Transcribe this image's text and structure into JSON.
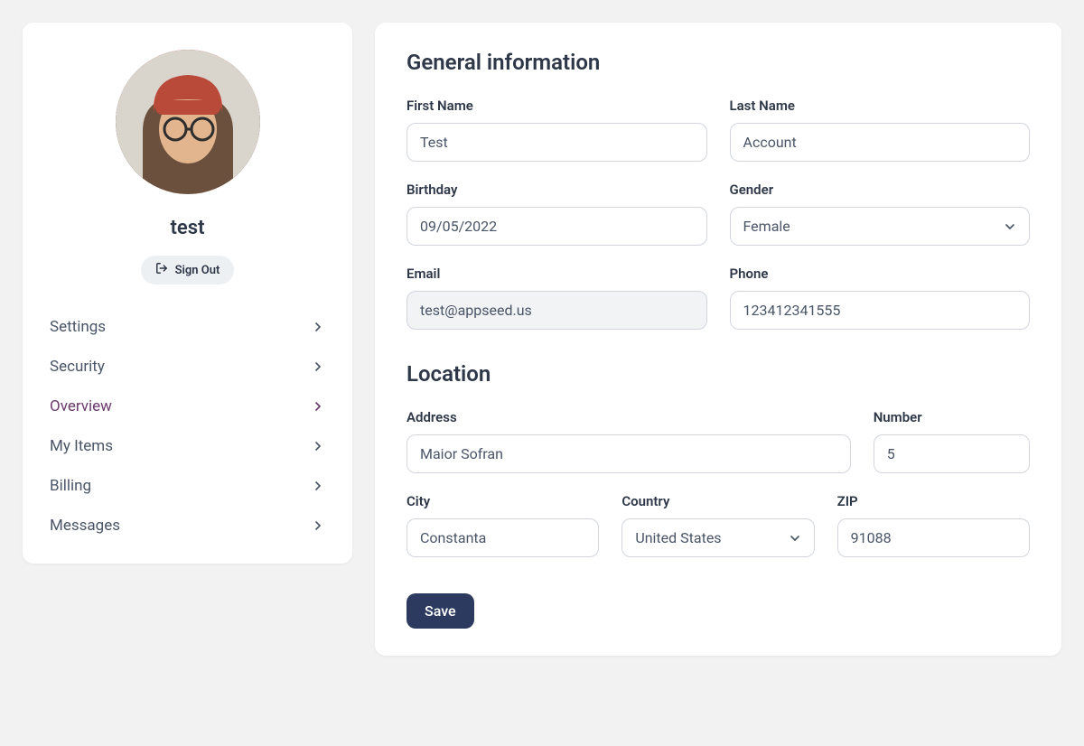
{
  "sidebar": {
    "username": "test",
    "signout_label": "Sign Out",
    "items": [
      {
        "label": "Settings",
        "active": false
      },
      {
        "label": "Security",
        "active": false
      },
      {
        "label": "Overview",
        "active": true
      },
      {
        "label": "My Items",
        "active": false
      },
      {
        "label": "Billing",
        "active": false
      },
      {
        "label": "Messages",
        "active": false
      }
    ]
  },
  "form": {
    "section_general": "General information",
    "section_location": "Location",
    "first_name_label": "First Name",
    "first_name_value": "Test",
    "last_name_label": "Last Name",
    "last_name_value": "Account",
    "birthday_label": "Birthday",
    "birthday_value": "09/05/2022",
    "gender_label": "Gender",
    "gender_value": "Female",
    "email_label": "Email",
    "email_value": "test@appseed.us",
    "phone_label": "Phone",
    "phone_value": "123412341555",
    "address_label": "Address",
    "address_value": "Maior Sofran",
    "number_label": "Number",
    "number_value": "5",
    "city_label": "City",
    "city_value": "Constanta",
    "country_label": "Country",
    "country_value": "United States",
    "zip_label": "ZIP",
    "zip_value": "91088",
    "save_label": "Save"
  }
}
